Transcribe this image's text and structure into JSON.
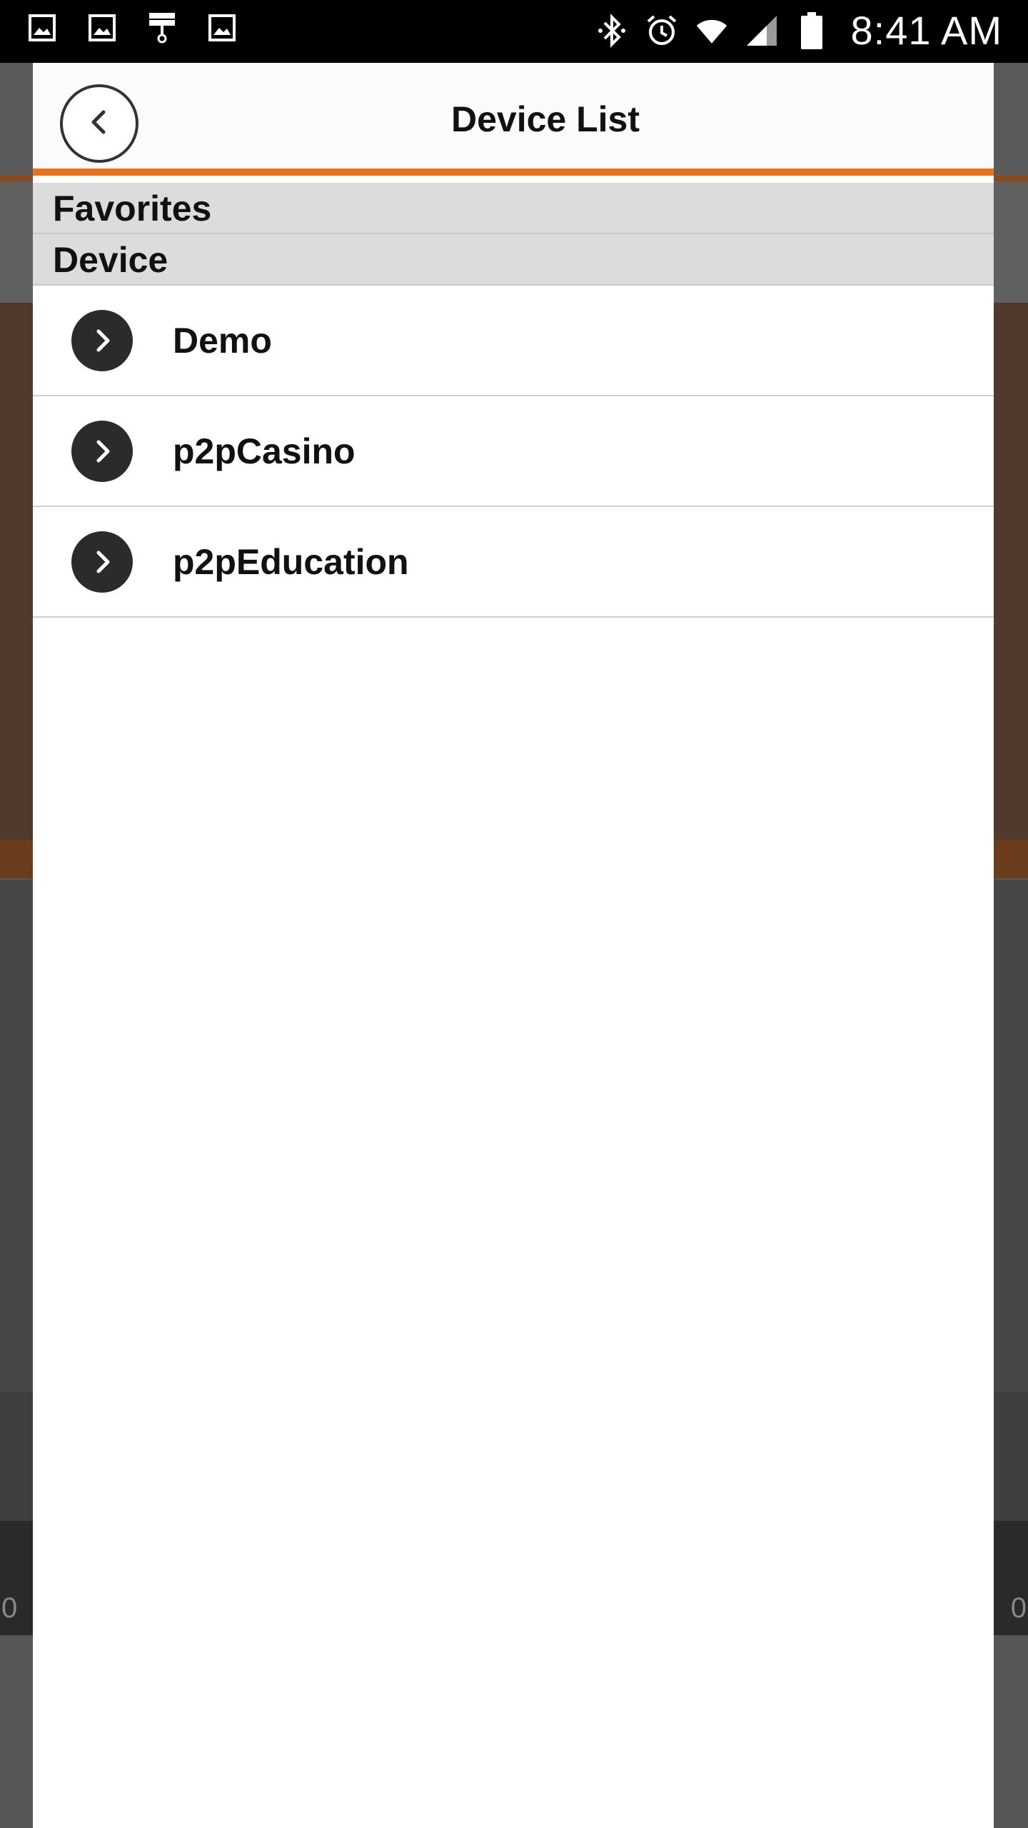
{
  "status_bar": {
    "time": "8:41 AM",
    "left_icons": [
      "image-icon",
      "image-icon",
      "paint-roller-icon",
      "image-icon"
    ],
    "right_icons": [
      "bluetooth-icon",
      "alarm-icon",
      "wifi-icon",
      "signal-icon",
      "battery-icon"
    ]
  },
  "drawer": {
    "title": "Device List",
    "back_icon": "chevron-left-icon",
    "accent_color": "#e8731c",
    "sections": {
      "favorites": "Favorites",
      "device": "Device"
    },
    "devices": [
      {
        "label": "Demo",
        "icon": "chevron-right-icon"
      },
      {
        "label": "p2pCasino",
        "icon": "chevron-right-icon"
      },
      {
        "label": "p2pEducation",
        "icon": "chevron-right-icon"
      }
    ]
  },
  "background": {
    "left_value": "0",
    "right_value": "0"
  }
}
